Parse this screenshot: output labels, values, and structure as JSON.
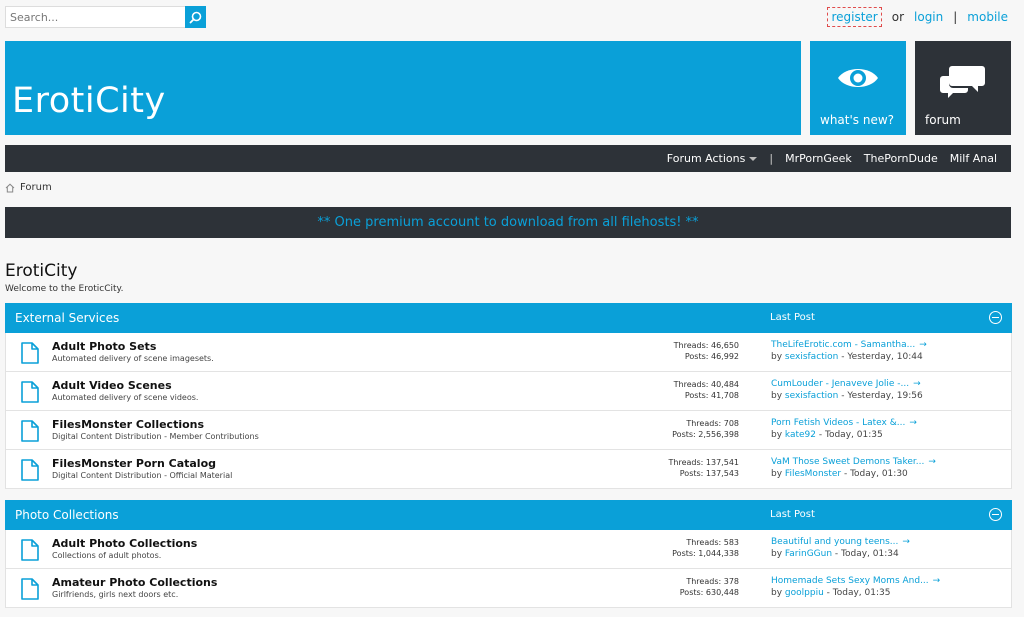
{
  "search": {
    "placeholder": "Search..."
  },
  "toplinks": {
    "register": "register",
    "or": "or",
    "login": "login",
    "sep": "|",
    "mobile": "mobile"
  },
  "header": {
    "site_name": "ErotiCity",
    "whats_new": "what's new?",
    "forum": "forum",
    "colors": {
      "accent": "#0aa0d8",
      "dark": "#2d3238"
    }
  },
  "navbar": {
    "items": [
      {
        "label": "Forum Actions",
        "dropdown": true
      },
      {
        "label": "|"
      },
      {
        "label": "MrPornGeek"
      },
      {
        "label": "ThePornDude"
      },
      {
        "label": "Milf Anal"
      }
    ]
  },
  "breadcrumb": {
    "label": "Forum",
    "icon": "home-icon"
  },
  "notice": {
    "text": "** One premium account to download from all filehosts! **"
  },
  "forum": {
    "title": "ErotiCity",
    "description": "Welcome to the EroticCity."
  },
  "categories": [
    {
      "title": "External Services",
      "last_post_label": "Last Post",
      "rows": [
        {
          "title": "Adult Photo Sets",
          "description": "Automated delivery of scene imagesets.",
          "threads": "Threads: 46,650",
          "posts": "Posts: 46,992",
          "last_title": "TheLifeErotic.com - Samantha...",
          "by": "by",
          "user": "sexisfaction",
          "time": " - Yesterday, 10:44"
        },
        {
          "title": "Adult Video Scenes",
          "description": "Automated delivery of scene videos.",
          "threads": "Threads: 40,484",
          "posts": "Posts: 41,708",
          "last_title": "CumLouder - Jenaveve Jolie -...",
          "by": "by",
          "user": "sexisfaction",
          "time": " - Yesterday, 19:56"
        },
        {
          "title": "FilesMonster Collections",
          "description": "Digital Content Distribution - Member Contributions",
          "threads": "Threads: 708",
          "posts": "Posts: 2,556,398",
          "last_title": "Porn Fetish Videos - Latex &...",
          "by": "by",
          "user": "kate92",
          "time": " - Today, 01:35"
        },
        {
          "title": "FilesMonster Porn Catalog",
          "description": "Digital Content Distribution - Official Material",
          "threads": "Threads: 137,541",
          "posts": "Posts: 137,543",
          "last_title": "VaM Those Sweet Demons Taker...",
          "by": "by",
          "user": "FilesMonster",
          "time": " - Today, 01:30"
        }
      ]
    },
    {
      "title": "Photo Collections",
      "last_post_label": "Last Post",
      "rows": [
        {
          "title": "Adult Photo Collections",
          "description": "Collections of adult photos.",
          "threads": "Threads: 583",
          "posts": "Posts: 1,044,338",
          "last_title": "Beautiful and young teens...",
          "by": "by",
          "user": "FarinGGun",
          "time": " - Today, 01:34"
        },
        {
          "title": "Amateur Photo Collections",
          "description": "Girlfriends, girls next doors etc.",
          "threads": "Threads: 378",
          "posts": "Posts: 630,448",
          "last_title": "Homemade Sets Sexy Moms And...",
          "by": "by",
          "user": "goolppiu",
          "time": " - Today, 01:35"
        }
      ]
    }
  ]
}
